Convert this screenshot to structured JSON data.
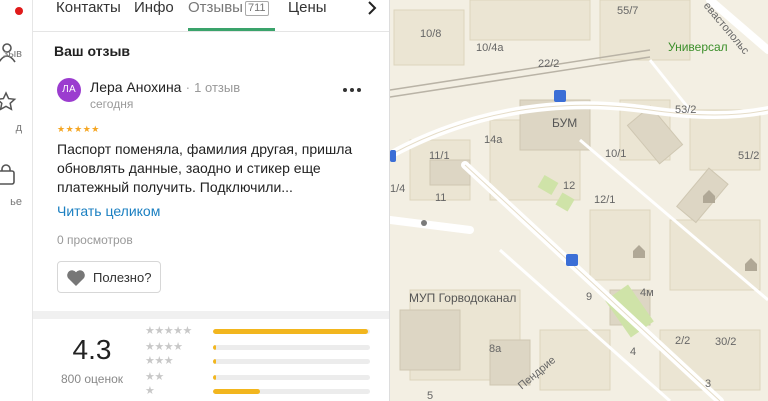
{
  "rail": {
    "items": [
      {
        "icon": "user-icon",
        "label": "зыв"
      },
      {
        "icon": "star-icon",
        "label": "д"
      },
      {
        "icon": "bag-icon",
        "label": "ье"
      }
    ]
  },
  "tabs": [
    {
      "label": "Контакты"
    },
    {
      "label": "Инфо"
    },
    {
      "label": "Отзывы",
      "count": "711"
    },
    {
      "label": "Цены"
    }
  ],
  "review": {
    "section_title": "Ваш отзыв",
    "avatar_initials": "ЛА",
    "author": "Лера Анохина",
    "separator": "·",
    "author_reviews": "1 отзыв",
    "date": "сегодня",
    "stars": "★★★★★",
    "text": "Паспорт поменяла, фамилия другая, пришла обновлять данные, заодно и стикер еще платежный получить. Подключили...",
    "read_more": "Читать целиком",
    "views": "0 просмотров",
    "helpful_label": "Полезно?"
  },
  "summary": {
    "rating": "4.3",
    "count_label": "800 оценок",
    "distribution": [
      {
        "stars": "★★★★★",
        "fraction": 0.99
      },
      {
        "stars": "★★★★",
        "fraction": 0.02
      },
      {
        "stars": "★★★",
        "fraction": 0.02
      },
      {
        "stars": "★★",
        "fraction": 0.02
      },
      {
        "stars": "★",
        "fraction": 0.3
      }
    ]
  },
  "map": {
    "labels": [
      "10/8",
      "10/4а",
      "55/7",
      "Универсал",
      "22/2",
      "БУМ",
      "53/2",
      "51/2",
      "14а",
      "10/1",
      "11/1",
      "12",
      "1/4",
      "11",
      "12/1",
      "МУП Горводоканал",
      "9",
      "4м",
      "8а",
      "2/2",
      "30/2",
      "Пендрие",
      "4",
      "5",
      "3"
    ],
    "street_label": "евастопольс"
  },
  "colors": {
    "accent_green": "#3aa36b",
    "link_blue": "#1a7fc1",
    "star_yellow": "#f5a623",
    "avatar_purple": "#9b3ccf",
    "notification_red": "#e01a1a"
  }
}
